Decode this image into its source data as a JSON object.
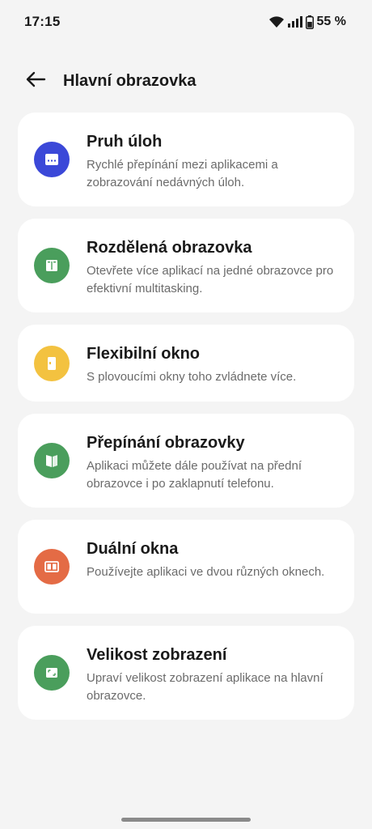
{
  "status_bar": {
    "time": "17:15",
    "battery_text": "55 %",
    "icons": [
      "wifi-icon",
      "signal-icon",
      "battery-icon"
    ]
  },
  "header": {
    "title": "Hlavní obrazovka",
    "back_icon": "arrow-left-icon"
  },
  "items": [
    {
      "title": "Pruh úloh",
      "description": "Rychlé přepínání mezi aplikacemi a zobrazování nedávných úloh.",
      "icon": "taskbar-icon",
      "color": "#3b48d8"
    },
    {
      "title": "Rozdělená obrazovka",
      "description": "Otevřete více aplikací na jedné obrazovce pro efektivní multitasking.",
      "icon": "split-screen-icon",
      "color": "#4a9e5c"
    },
    {
      "title": "Flexibilní okno",
      "description": "S plovoucími okny toho zvládnete více.",
      "icon": "floating-window-icon",
      "color": "#f3c240"
    },
    {
      "title": "Přepínání obrazovky",
      "description": "Aplikaci můžete dále používat na přední obrazovce i po zaklapnutí telefonu.",
      "icon": "fold-screen-icon",
      "color": "#4a9e5c"
    },
    {
      "title": "Duální okna",
      "description": "Používejte aplikaci ve dvou různých oknech.",
      "icon": "dual-window-icon",
      "color": "#e46b45"
    },
    {
      "title": "Velikost zobrazení",
      "description": "Upraví velikost zobrazení aplikace na hlavní obrazovce.",
      "icon": "display-size-icon",
      "color": "#4a9e5c"
    }
  ]
}
